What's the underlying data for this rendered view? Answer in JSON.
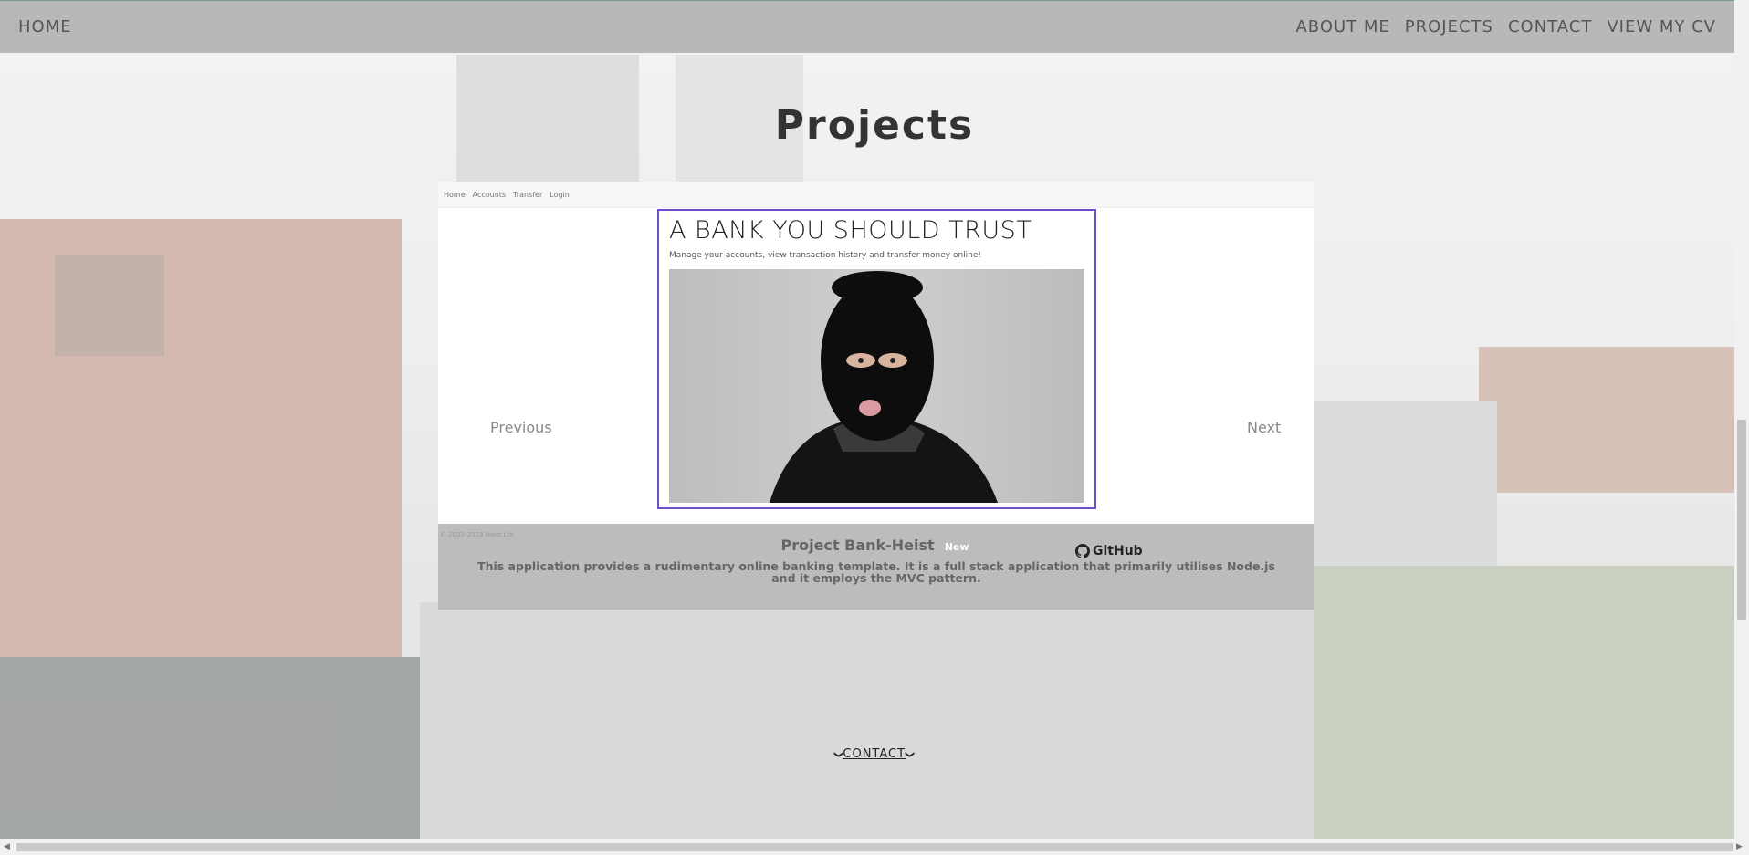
{
  "navbar": {
    "home": "HOME",
    "links": [
      "ABOUT ME",
      "PROJECTS",
      "CONTACT",
      "VIEW MY CV"
    ]
  },
  "page": {
    "title": "Projects"
  },
  "carousel": {
    "mini_nav": [
      "Home",
      "Accounts",
      "Transfer",
      "Login"
    ],
    "slide": {
      "heading": "A BANK YOU SHOULD TRUST",
      "subheading": "Manage your accounts, view transaction history and transfer money online!",
      "image_icon": "balaclava-person-photo"
    },
    "prev_label": "Previous",
    "next_label": "Next"
  },
  "caption": {
    "footnote": "© 2022-2023 Heist Ltd",
    "title": "Project Bank-Heist",
    "badge": "New",
    "github_label": "GitHub",
    "github_icon": "github-icon",
    "description": "This application provides a rudimentary online banking template. It is a full stack application that primarily utilises Node.js and it employs the MVC pattern."
  },
  "contact": {
    "label": "CONTACT",
    "icon": "chevron-down-icon"
  },
  "colors": {
    "navbar": "#b8b8b8",
    "frame_border": "#6c4fc9",
    "caption_bg": "#bcbcbc"
  }
}
